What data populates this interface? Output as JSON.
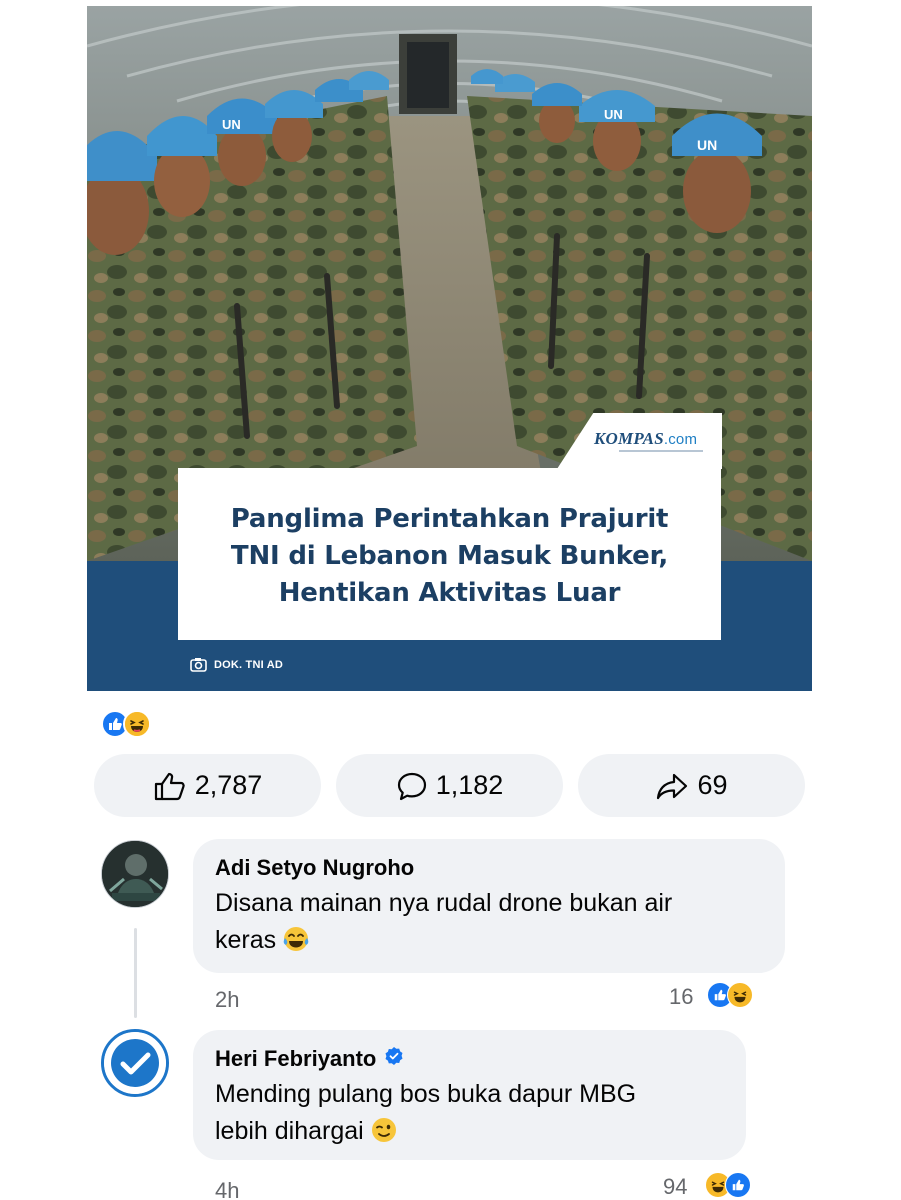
{
  "post": {
    "headline": {
      "line1": "Panglima Perintahkan Prajurit",
      "line2": "TNI di Lebanon Masuk Bunker,",
      "line3": "Hentikan Aktivitas Luar"
    },
    "publisher": {
      "name": "KOMPAS",
      "suffix": ".com"
    },
    "photo_credit": "DOK. TNI AD",
    "helmet_text": "UN",
    "colors": {
      "band": "#1f4e7b",
      "headline": "#1c3f63",
      "like_blue": "#1877f2",
      "haha_yellow": "#f7b928"
    }
  },
  "reactions": {
    "icons": [
      "like-icon",
      "haha-icon"
    ],
    "like_count": "2,787",
    "comment_count": "1,182",
    "share_count": "69"
  },
  "comments": [
    {
      "author": "Adi Setyo Nugroho",
      "text_line1": "Disana mainan nya rudal drone bukan air",
      "text_line2": "keras",
      "emoji": "tears-of-joy-icon",
      "time": "2h",
      "reaction_count": "16"
    },
    {
      "author": "Heri Febriyanto",
      "verified": true,
      "text_line1": "Mending pulang bos buka dapur MBG",
      "text_line2": "lebih dihargai",
      "emoji": "wink-icon",
      "time": "4h",
      "reaction_count": "94"
    }
  ]
}
